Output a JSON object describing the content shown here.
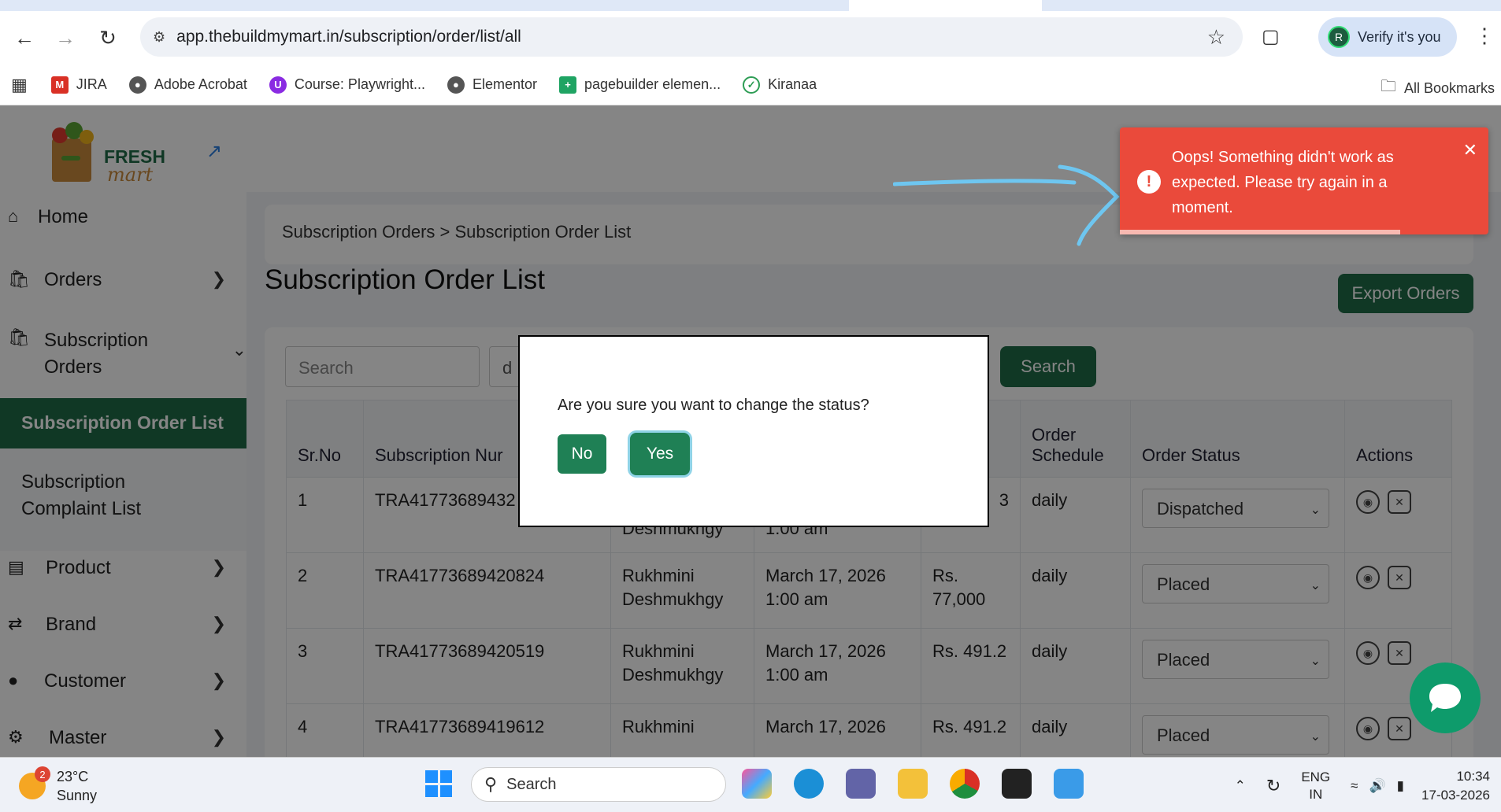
{
  "browser": {
    "url": "app.thebuildmymart.in/subscription/order/list/all",
    "verify_label": "Verify it's you",
    "profile_initial": "R",
    "bookmarks": [
      {
        "label": "JIRA",
        "color": "#d93025"
      },
      {
        "label": "Adobe Acrobat",
        "color": "#555555"
      },
      {
        "label": "Course: Playwright...",
        "color": "#8a2be2"
      },
      {
        "label": "Elementor",
        "color": "#555555"
      },
      {
        "label": "pagebuilder elemen...",
        "color": "#1fa463"
      },
      {
        "label": "Kiranaa",
        "color": "#2e9d55"
      }
    ],
    "all_bookmarks": "All Bookmarks"
  },
  "sidebar": {
    "logo_top": "FRESH",
    "logo_bottom": "mart",
    "items": [
      {
        "label": "Home",
        "icon": "home-icon"
      },
      {
        "label": "Orders",
        "icon": "bag-icon"
      },
      {
        "label": "Subscription\nOrders",
        "icon": "bag-icon"
      },
      {
        "label": "Product",
        "icon": "box-icon"
      },
      {
        "label": "Brand",
        "icon": "shuffle-icon"
      },
      {
        "label": "Customer",
        "icon": "user-icon"
      },
      {
        "label": "Master",
        "icon": "users-gear-icon"
      }
    ],
    "active_sub": "Subscription Order List",
    "other_sub": "Subscription\nComplaint List"
  },
  "main": {
    "breadcrumb": "Subscription Orders > Subscription Order List",
    "title": "Subscription Order List",
    "export_label": "Export Orders",
    "search_placeholder": "Search",
    "select_value": "d",
    "search_button": "Search",
    "columns": [
      "Sr.No",
      "Subscription Nur",
      "",
      "",
      "",
      "Order\nSchedule",
      "Order Status",
      "Actions"
    ],
    "rows": [
      {
        "sr": "1",
        "sub": "TRA41773689432",
        "name": "Deshmukhgy",
        "date": "1:00 am",
        "amt": "3",
        "sched": "daily",
        "status": "Dispatched"
      },
      {
        "sr": "2",
        "sub": "TRA41773689420824",
        "name": "Rukhmini\nDeshmukhgy",
        "date": "March 17, 2026\n1:00 am",
        "amt": "Rs.\n77,000",
        "sched": "daily",
        "status": "Placed"
      },
      {
        "sr": "3",
        "sub": "TRA41773689420519",
        "name": "Rukhmini\nDeshmukhgy",
        "date": "March 17, 2026\n1:00 am",
        "amt": "Rs. 491.2",
        "sched": "daily",
        "status": "Placed"
      },
      {
        "sr": "4",
        "sub": "TRA41773689419612",
        "name": "Rukhmini",
        "date": "March 17, 2026",
        "amt": "Rs. 491.2",
        "sched": "daily",
        "status": "Placed"
      }
    ]
  },
  "modal": {
    "question": "Are you sure you want to change the status?",
    "no_label": "No",
    "yes_label": "Yes"
  },
  "toast": {
    "message": "Oops! Something didn't work as expected. Please try again in a moment.",
    "progress": 0.76,
    "color": "#ea4a3b"
  },
  "taskbar": {
    "temp": "23°C",
    "weather": "Sunny",
    "badge": "2",
    "search": "Search",
    "lang1": "ENG",
    "lang2": "IN",
    "time": "10:34",
    "date": "17-03-2026"
  }
}
